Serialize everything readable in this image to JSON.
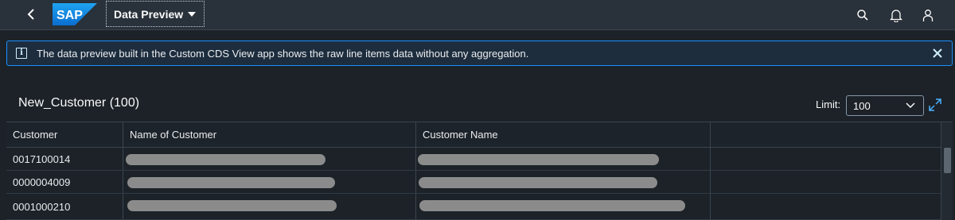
{
  "shell": {
    "title": "Data Preview",
    "logo_text": "SAP",
    "colors": {
      "bar": "#29313a",
      "logo": "#0a6ed1",
      "accent": "#1b90ff"
    },
    "icons": [
      "back-icon",
      "search-icon",
      "bell-icon",
      "user-icon"
    ]
  },
  "info_strip": {
    "icon": "information-icon",
    "icon_glyph": "i",
    "message": "The data preview built in the Custom CDS View app shows the raw line items data without any aggregation."
  },
  "table": {
    "title": "New_Customer (100)",
    "limit_label": "Limit:",
    "limit_value": "100",
    "columns": [
      "Customer",
      "Name of Customer",
      "Customer Name"
    ],
    "rows": [
      {
        "customer": "0017100014"
      },
      {
        "customer": "0000004009"
      },
      {
        "customer": "0001000210"
      }
    ]
  }
}
